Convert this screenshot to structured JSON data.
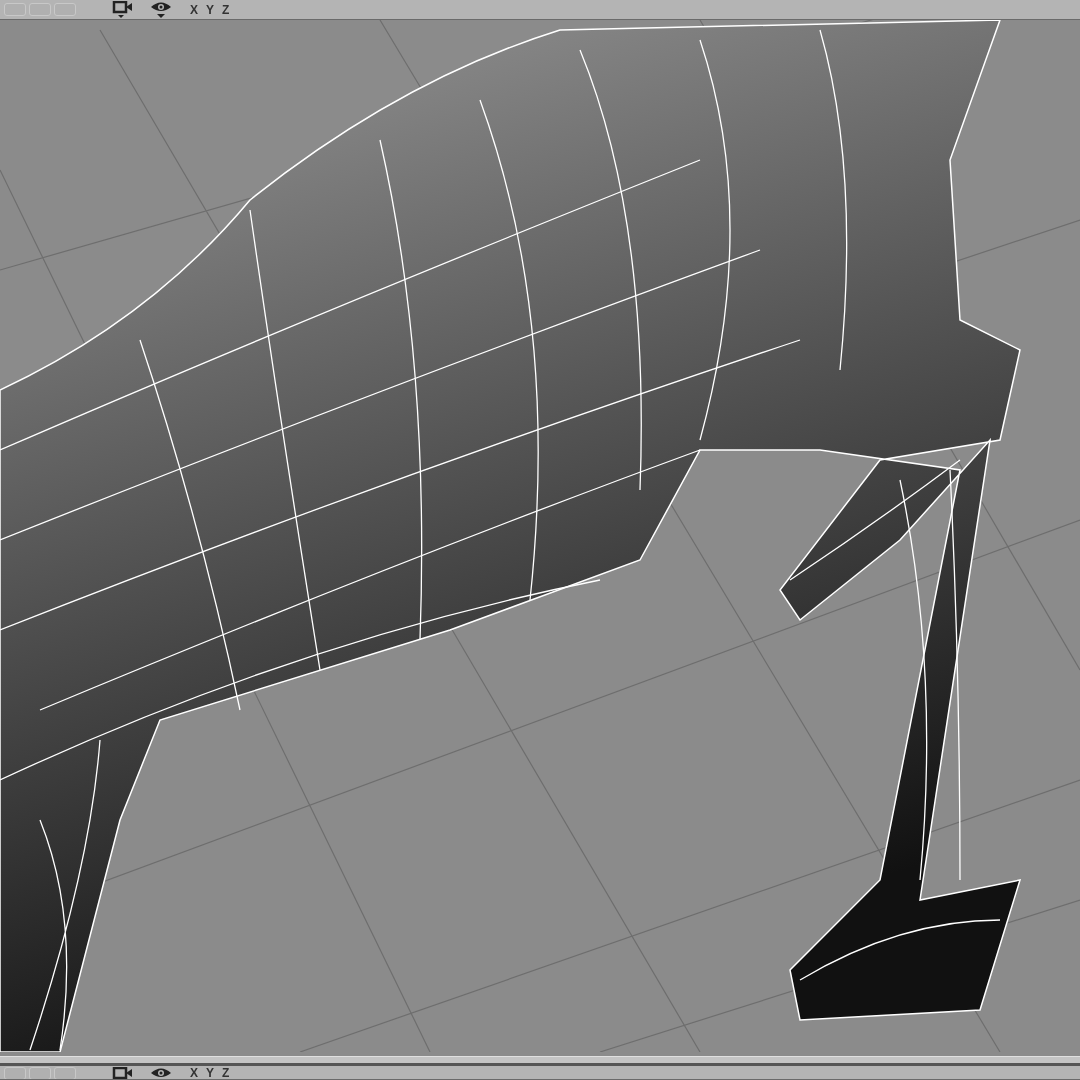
{
  "viewports": [
    {
      "toolbar": {
        "axes": [
          "X",
          "Y",
          "Z"
        ]
      }
    },
    {
      "toolbar": {
        "axes": [
          "X",
          "Y",
          "Z"
        ]
      }
    }
  ]
}
